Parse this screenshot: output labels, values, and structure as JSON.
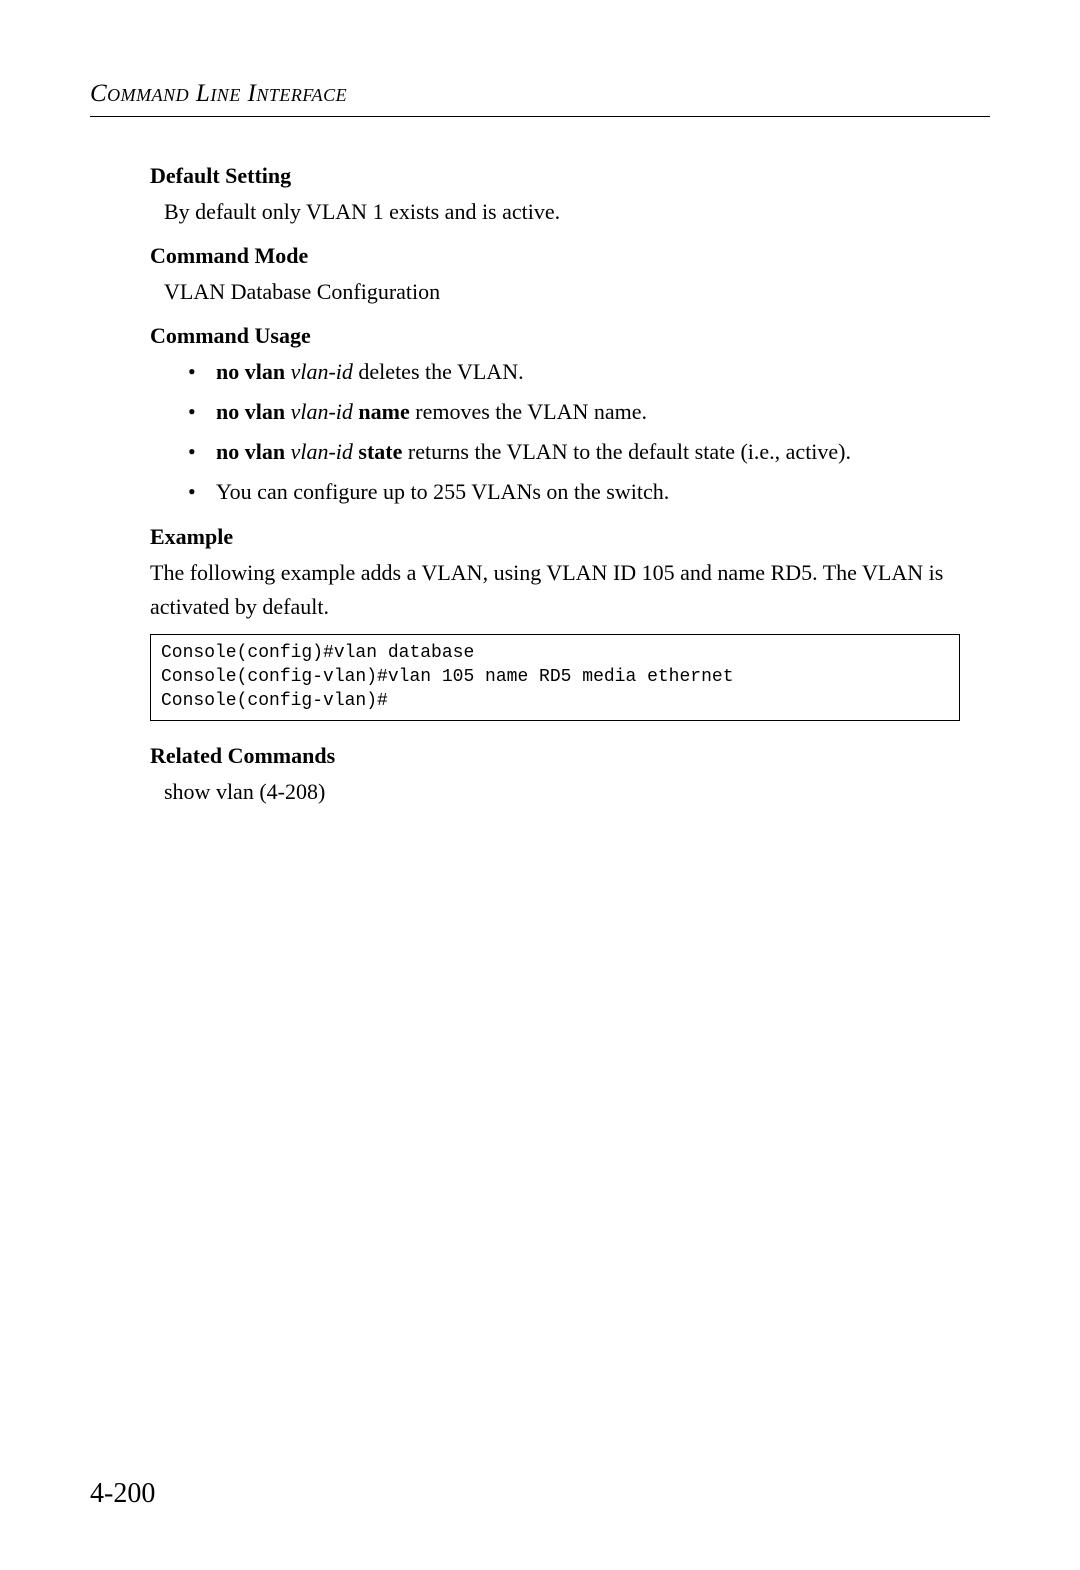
{
  "header": {
    "chapter": "Command Line Interface"
  },
  "s1": {
    "heading": "Default Setting",
    "body": "By default only VLAN 1 exists and is active."
  },
  "s2": {
    "heading": "Command Mode",
    "body": "VLAN Database Configuration"
  },
  "s3": {
    "heading": "Command Usage",
    "bullets": [
      {
        "b1": "no vlan",
        "i1": " vlan-id",
        "t1": " deletes the VLAN."
      },
      {
        "b1": "no vlan",
        "i1": " vlan-id",
        "b2": " name",
        "t1": " removes the VLAN name."
      },
      {
        "b1": "no vlan",
        "i1": " vlan-id",
        "b2": " state",
        "t1": " returns the VLAN to the default state (i.e., active)."
      },
      {
        "t1": "You can configure up to 255 VLANs on the switch."
      }
    ]
  },
  "s4": {
    "heading": "Example",
    "intro": "The following example adds a VLAN, using VLAN ID 105 and name RD5. The VLAN is activated by default.",
    "code": "Console(config)#vlan database\nConsole(config-vlan)#vlan 105 name RD5 media ethernet\nConsole(config-vlan)#"
  },
  "s5": {
    "heading": "Related Commands",
    "body": "show vlan (4-208)"
  },
  "pageNumber": "4-200"
}
